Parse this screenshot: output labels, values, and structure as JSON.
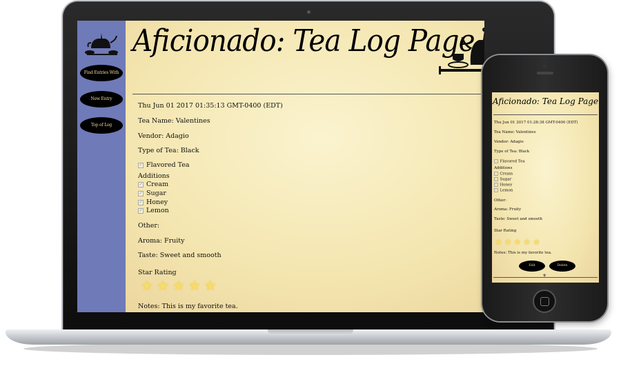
{
  "laptop": {
    "title": "Aficionado: Tea Log Page",
    "sidebar": {
      "buttons": [
        "Find Entries With",
        "New Entry",
        "Top of Log"
      ]
    },
    "entry": {
      "timestamp": "Thu Jun 01 2017 01:35:13 GMT-0400 (EDT)",
      "tea_name": "Tea Name: Valentines",
      "vendor": "Vendor: Adagio",
      "type": "Type of Tea: Black",
      "flavored": "Flavored Tea",
      "additions_label": "Additions",
      "additions": [
        "Cream",
        "Sugar",
        "Honey",
        "Lemon"
      ],
      "other": "Other:",
      "aroma": "Aroma: Fruity",
      "taste": "Taste: Sweet and smooth",
      "star_label": "Star Rating",
      "stars": 5,
      "notes": "Notes: This is my favorite tea."
    }
  },
  "phone": {
    "title": "Aficionado: Tea Log Page",
    "entry": {
      "timestamp": "Thu Jun 01 2017 01:28:38 GMT-0400 (EDT)",
      "tea_name": "Tea Name: Valentines",
      "vendor": "Vendor: Adagio",
      "type": "Type of Tea: Black",
      "flavored": "Flavored Tea",
      "additions_label": "Additions",
      "additions": [
        "Cream",
        "Sugar",
        "Honey",
        "Lemon"
      ],
      "other": "Other:",
      "aroma": "Aroma: Fruity",
      "taste": "Taste: Sweet and smooth",
      "star_label": "Star Rating",
      "stars": 5,
      "notes": "Notes: This is my favorite tea."
    },
    "edit_label": "Edit",
    "delete_label": "Delete"
  },
  "colors": {
    "sidebar": "#6f7ab8",
    "parchment": "#f4e6b0",
    "button": "#000000",
    "button_text": "#f0d8a0",
    "star": "#f6dc6a"
  },
  "icons": {
    "logo": "teapot-icon",
    "header_art": "tea-set-icon",
    "checkbox": "checkbox-icon",
    "star": "star-icon"
  }
}
